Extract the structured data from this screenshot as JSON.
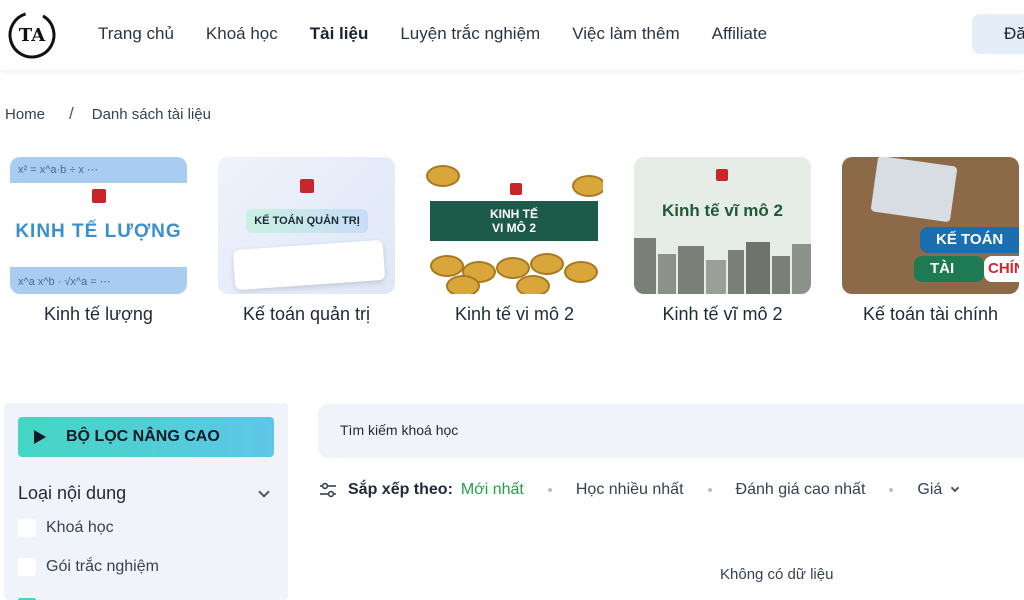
{
  "header": {
    "logo_text": "TA",
    "nav": [
      "Trang chủ",
      "Khoá học",
      "Tài liệu",
      "Luyện trắc nghiệm",
      "Việc làm thêm",
      "Affiliate"
    ],
    "active_nav": "Tài liệu",
    "login_label": "Đăng"
  },
  "breadcrumb": {
    "home": "Home",
    "separator": "/",
    "current": "Danh sách tài liệu"
  },
  "courses": [
    {
      "title": "Kinh tế lượng",
      "thumb_text": "KINH TẾ LƯỢNG"
    },
    {
      "title": "Kế toán quản trị",
      "thumb_text": "KẾ TOÁN QUẢN TRỊ"
    },
    {
      "title": "Kinh tế vi mô 2",
      "thumb_text": "KINH TẾ\nVI MÔ 2"
    },
    {
      "title": "Kinh tế vĩ mô 2",
      "thumb_text": "Kinh tế vĩ mô 2"
    },
    {
      "title": "Kế toán tài chính",
      "thumb_text": [
        "KẾ TOÁN",
        "TÀI",
        "CHÍN"
      ]
    }
  ],
  "filter": {
    "button_label": "BỘ LỌC NÂNG CAO",
    "section_title": "Loại nội dung",
    "options": [
      "Khoá học",
      "Gói trắc nghiệm"
    ]
  },
  "search": {
    "placeholder": "Tìm kiếm khoá học"
  },
  "sort": {
    "label": "Sắp xếp theo:",
    "options": [
      "Mới nhất",
      "Học nhiều nhất",
      "Đánh giá cao nhất"
    ],
    "active": "Mới nhất",
    "price_label": "Giá"
  },
  "empty_message": "Không có dữ liệu",
  "colors": {
    "accent_green": "#22a04a",
    "filter_gradient_start": "#44d6c2",
    "filter_gradient_end": "#5ec6e8",
    "panel_bg": "#f1f3fa"
  }
}
